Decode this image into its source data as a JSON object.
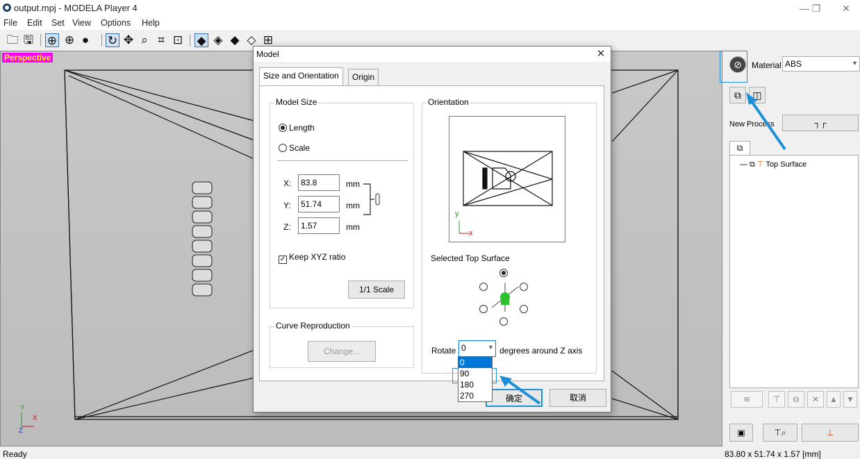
{
  "window": {
    "title": "output.mpj - MODELA Player 4",
    "controls": {
      "minimize": "—",
      "restore": "❐",
      "close": "✕"
    }
  },
  "menu": [
    "File",
    "Edit",
    "Set",
    "View",
    "Options",
    "Help"
  ],
  "toolbar": {
    "icons": [
      "open-folder-icon",
      "save-icon",
      "globe-wire-icon",
      "globe-icon",
      "sphere-icon",
      "rotate-icon",
      "pan-icon",
      "zoom-icon",
      "fit-icon",
      "zoom-selection-icon",
      "view-iso-icon",
      "view-front-icon",
      "view-side-icon",
      "view-top-icon",
      "grid-icon"
    ]
  },
  "viewport": {
    "view_label": "Perspective",
    "axis": {
      "y": "Y",
      "x": "X",
      "z": "Z"
    },
    "colors": {
      "label_bg": "#ff00ff",
      "label_fg": "#ffff00"
    }
  },
  "right_panel": {
    "material_label": "Material",
    "material_value": "ABS",
    "new_process_label": "New Process",
    "tree_item": "Top Surface"
  },
  "status": {
    "left": "Ready",
    "right": "83.80 x 51.74 x 1.57 [mm]"
  },
  "dialog": {
    "title": "Model",
    "tabs": [
      "Size and Orientation",
      "Origin"
    ],
    "model_size": {
      "group_title": "Model Size",
      "radio_length": "Length",
      "radio_scale": "Scale",
      "x_label": "X:",
      "x_value": "83.8",
      "y_label": "Y:",
      "y_value": "51.74",
      "z_label": "Z:",
      "z_value": "1.57",
      "unit": "mm",
      "keep_ratio": "Keep XYZ ratio",
      "scale_button": "1/1 Scale"
    },
    "curve": {
      "group_title": "Curve Reproduction",
      "change_button": "Change..."
    },
    "orientation": {
      "group_title": "Orientation",
      "preview_axis_y": "y",
      "preview_axis_x": "x",
      "selected_label": "Selected Top Surface"
    },
    "rotate": {
      "label": "Rotate",
      "value": "0",
      "suffix": "degrees around Z axis",
      "options": [
        "0",
        "90",
        "180",
        "270"
      ]
    },
    "ok": "确定",
    "cancel": "取消"
  },
  "colors": {
    "accent": "#0078d7",
    "annotation_arrow": "#1e90d8"
  }
}
